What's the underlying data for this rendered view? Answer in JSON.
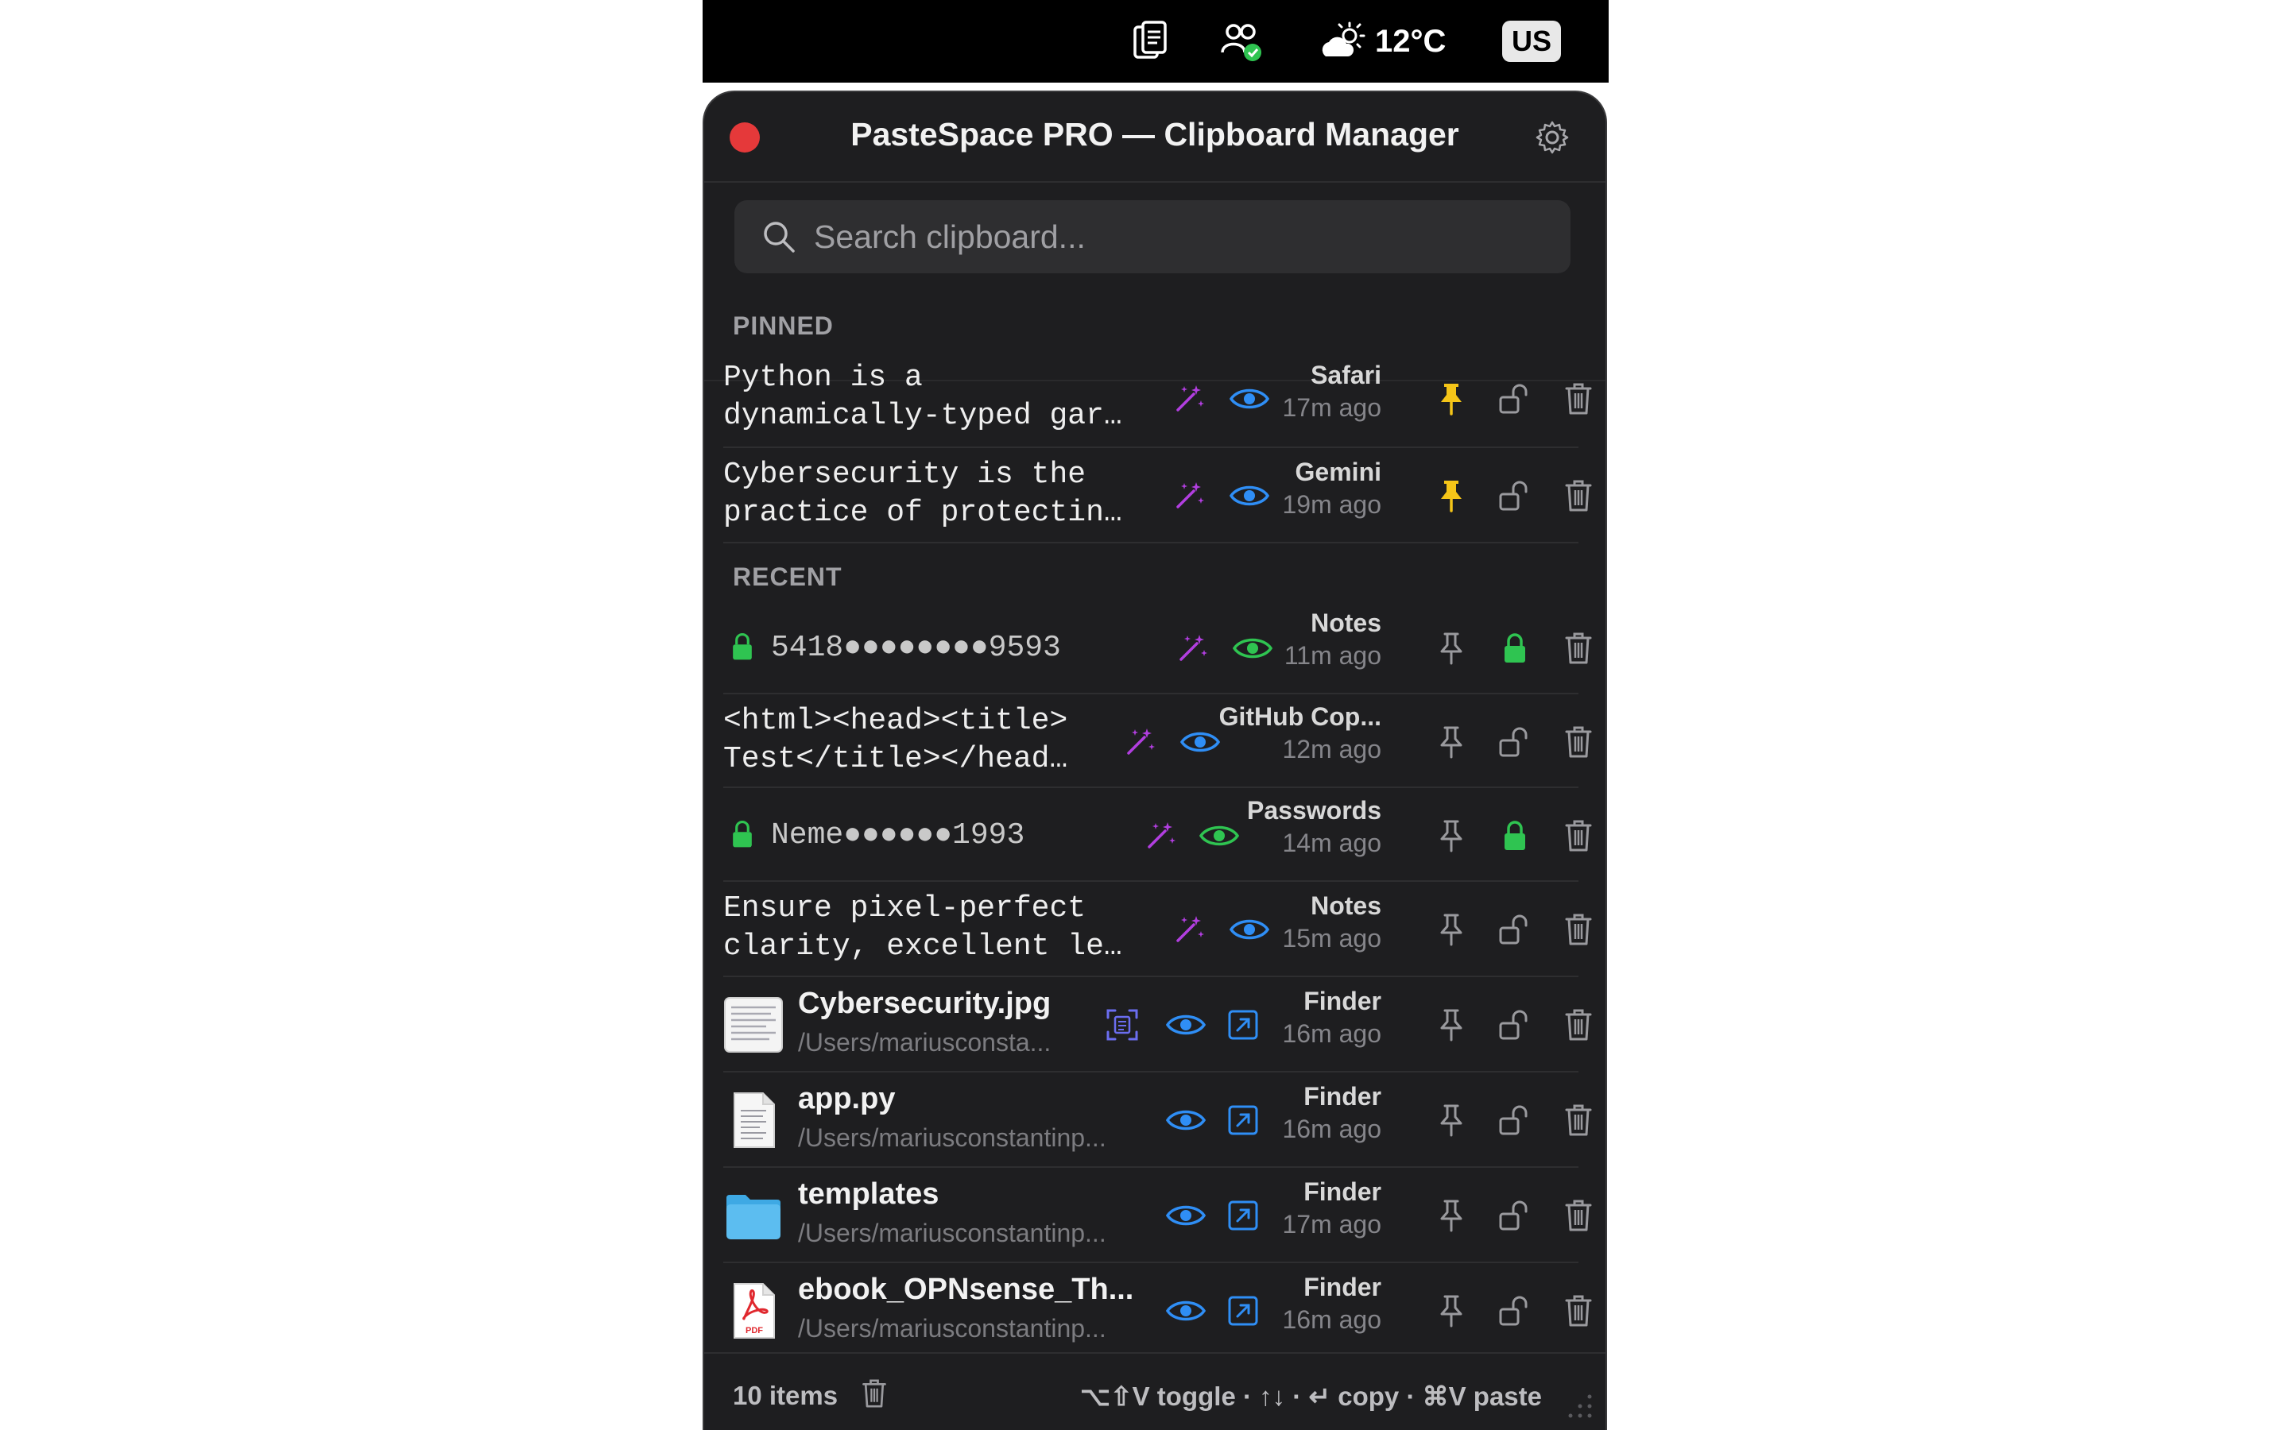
{
  "menubar": {
    "weather_temp": "12°C",
    "language": "US",
    "icons": [
      "clipboard-icon",
      "people-check-icon",
      "weather-sun-cloud-icon"
    ]
  },
  "window": {
    "title": "PasteSpace PRO — Clipboard Manager"
  },
  "search": {
    "placeholder": "Search clipboard..."
  },
  "sections": {
    "pinned": "PINNED",
    "recent": "RECENT"
  },
  "pinned_items": [
    {
      "line1": "Python is a",
      "line2": "dynamically-typed gar…",
      "app": "Safari",
      "time": "17m ago"
    },
    {
      "line1": "Cybersecurity is the",
      "line2": "practice of protectin…",
      "app": "Gemini",
      "time": "19m ago"
    }
  ],
  "recent_items": [
    {
      "kind": "secure",
      "text": "5418●●●●●●●●9593",
      "app": "Notes",
      "time": "11m ago"
    },
    {
      "kind": "text",
      "line1": "<html><head><title>",
      "line2": "Test</title></head…",
      "app": "GitHub Cop...",
      "time": "12m ago"
    },
    {
      "kind": "secure",
      "text": "Neme●●●●●●1993",
      "app": "Passwords",
      "time": "14m ago"
    },
    {
      "kind": "text",
      "line1": "Ensure pixel-perfect",
      "line2": "clarity, excellent le…",
      "app": "Notes",
      "time": "15m ago"
    },
    {
      "kind": "file",
      "icon": "image-thumbnail-icon",
      "name": "Cybersecurity.jpg",
      "path": "/Users/mariusconsta...",
      "app": "Finder",
      "time": "16m ago"
    },
    {
      "kind": "file",
      "icon": "document-file-icon",
      "name": "app.py",
      "path": "/Users/mariusconstantinp...",
      "app": "Finder",
      "time": "16m ago"
    },
    {
      "kind": "file",
      "icon": "folder-icon",
      "name": "templates",
      "path": "/Users/mariusconstantinp...",
      "app": "Finder",
      "time": "17m ago"
    },
    {
      "kind": "file",
      "icon": "pdf-file-icon",
      "pdf_label": "PDF",
      "name": "ebook_OPNsense_Th...",
      "path": "/Users/mariusconstantinp...",
      "app": "Finder",
      "time": "16m ago"
    }
  ],
  "footer": {
    "count": "10 items",
    "hint": "⌥⇧V toggle · ↑↓ · ↵ copy · ⌘V paste"
  },
  "colors": {
    "accent_blue": "#2f8ef5",
    "magic_purple": "#b23ee0",
    "pin_yellow": "#f5c518",
    "secure_green": "#2fc451",
    "close_red": "#e5393a"
  }
}
